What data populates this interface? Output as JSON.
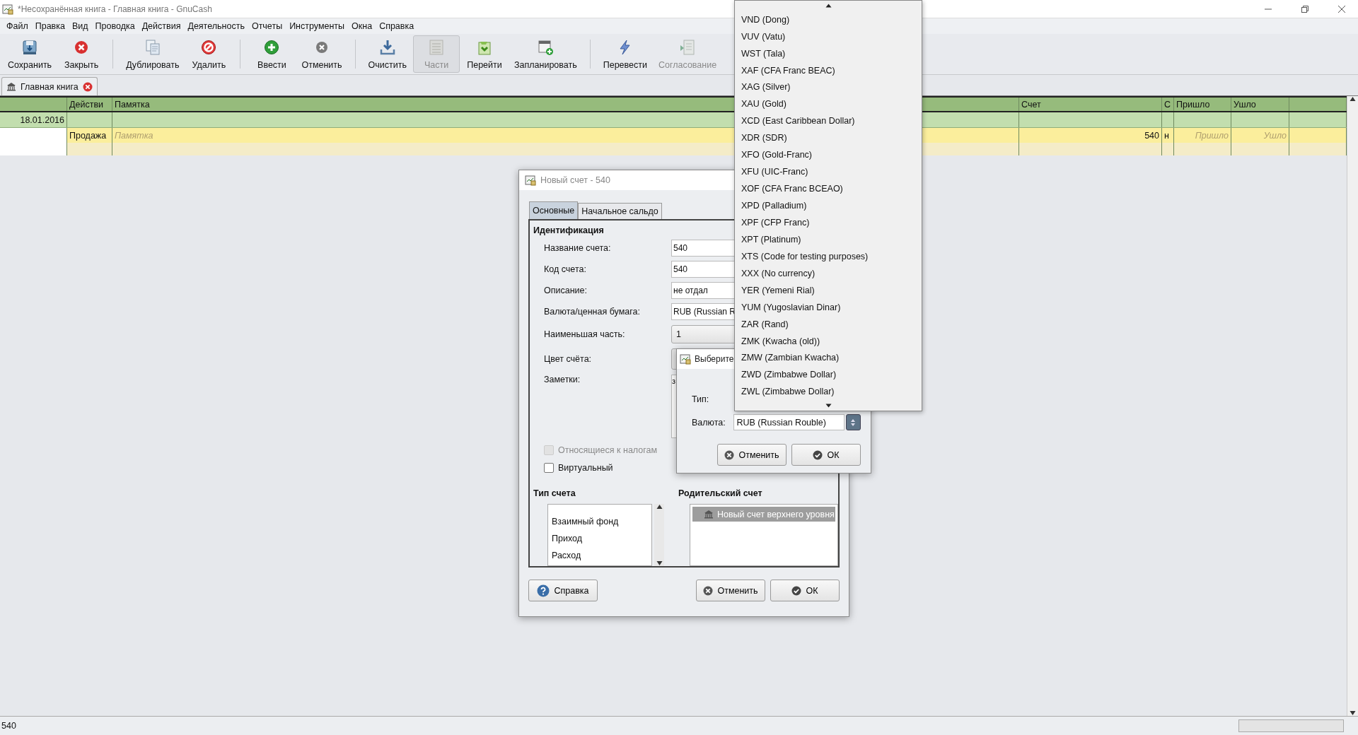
{
  "window": {
    "title": "*Несохранённая книга - Главная книга - GnuCash"
  },
  "menu": [
    "Файл",
    "Правка",
    "Вид",
    "Проводка",
    "Действия",
    "Деятельность",
    "Отчеты",
    "Инструменты",
    "Окна",
    "Справка"
  ],
  "toolbar": [
    {
      "items": [
        {
          "label": "Сохранить",
          "kind": "save",
          "disabled": false,
          "pressed": false
        },
        {
          "label": "Закрыть",
          "kind": "close",
          "disabled": false,
          "pressed": false
        }
      ]
    },
    {
      "items": [
        {
          "label": "Дублировать",
          "kind": "duplicate",
          "disabled": false,
          "pressed": false
        },
        {
          "label": "Удалить",
          "kind": "delete",
          "disabled": false,
          "pressed": false
        }
      ]
    },
    {
      "items": [
        {
          "label": "Ввести",
          "kind": "enter",
          "disabled": false,
          "pressed": false
        },
        {
          "label": "Отменить",
          "kind": "cancel",
          "disabled": false,
          "pressed": false
        }
      ]
    },
    {
      "items": [
        {
          "label": "Очистить",
          "kind": "blank",
          "disabled": false,
          "pressed": false
        },
        {
          "label": "Части",
          "kind": "split",
          "disabled": true,
          "pressed": true
        },
        {
          "label": "Перейти",
          "kind": "jump",
          "disabled": false,
          "pressed": false
        },
        {
          "label": "Запланировать",
          "kind": "schedule",
          "disabled": false,
          "pressed": false
        }
      ]
    },
    {
      "items": [
        {
          "label": "Перевести",
          "kind": "transfer",
          "disabled": false,
          "pressed": false
        },
        {
          "label": "Согласование",
          "kind": "reconcile",
          "disabled": true,
          "pressed": false
        }
      ]
    }
  ],
  "tabs": [
    {
      "label": "Главная книга",
      "selected": true
    }
  ],
  "register": {
    "columns": [
      "Действи",
      "Памятка",
      "Счет",
      "С",
      "Пришло",
      "Ушло"
    ],
    "rows": [
      {
        "kind": "transaction",
        "date": "18.01.2016",
        "selected": false
      },
      {
        "kind": "split",
        "cells": [
          {
            "value": "Продажа"
          },
          {
            "placeholder": "Памятка"
          },
          {
            "value": "540"
          },
          {
            "value": "н"
          },
          {
            "placeholder": "Пришло"
          },
          {
            "placeholder": "Ушло"
          }
        ],
        "selected": true
      },
      {
        "kind": "blank",
        "selected": false
      }
    ]
  },
  "status_bar": {
    "text": "540"
  },
  "account_dialog": {
    "title": "Новый счет - 540",
    "tabs": [
      {
        "label": "Основные",
        "selected": true
      },
      {
        "label": "Начальное сальдо",
        "selected": false
      }
    ],
    "section": "Идентификация",
    "fields": [
      {
        "kind": "text",
        "label": "Название счета:",
        "value": "540"
      },
      {
        "kind": "text",
        "label": "Код счета:",
        "value": "540"
      },
      {
        "kind": "text",
        "label": "Описание:",
        "value": "не отдал"
      },
      {
        "kind": "text",
        "label": "Валюта/ценная бумага:",
        "value": "RUB (Russian R"
      },
      {
        "kind": "combo",
        "label": "Наименьшая часть:",
        "value": "1"
      },
      {
        "kind": "color",
        "label": "Цвет счёта:"
      },
      {
        "kind": "notes",
        "label": "Заметки:",
        "value": "з"
      }
    ],
    "checkboxes": [
      {
        "label": "Относящиеся к налогам",
        "checked": false,
        "disabled": true
      },
      {
        "label": "Виртуальный",
        "checked": false,
        "disabled": false
      }
    ],
    "type_heading": "Тип счета",
    "types": [
      {
        "label": "Взаимный фонд",
        "selected": false
      },
      {
        "label": "Приход",
        "selected": false
      },
      {
        "label": "Расход",
        "selected": false
      }
    ],
    "parent_heading": "Родительский счет",
    "parents": [
      {
        "label": "Новый счет верхнего уровня",
        "selected": true
      }
    ],
    "buttons": [
      {
        "kind": "help",
        "label": "Справка"
      },
      {
        "kind": "cancel",
        "label": "Отменить"
      },
      {
        "kind": "ok",
        "label": "ОК"
      }
    ]
  },
  "commodity_dialog": {
    "title": "Выберите",
    "type_label": "Тип:",
    "currency_label": "Валюта:",
    "currency": "RUB (Russian Rouble)",
    "buttons": [
      {
        "kind": "cancel",
        "label": "Отменить"
      },
      {
        "kind": "ok",
        "label": "ОК"
      }
    ]
  },
  "currency_dropdown": {
    "items": [
      {
        "label": "VND (Dong)"
      },
      {
        "label": "VUV (Vatu)"
      },
      {
        "label": "WST (Tala)"
      },
      {
        "label": "XAF (CFA Franc BEAC)"
      },
      {
        "label": "XAG (Silver)"
      },
      {
        "label": "XAU (Gold)"
      },
      {
        "label": "XCD (East Caribbean Dollar)"
      },
      {
        "label": "XDR (SDR)"
      },
      {
        "label": "XFO (Gold-Franc)"
      },
      {
        "label": "XFU (UIC-Franc)"
      },
      {
        "label": "XOF (CFA Franc BCEAO)"
      },
      {
        "label": "XPD (Palladium)"
      },
      {
        "label": "XPF (CFP Franc)"
      },
      {
        "label": "XPT (Platinum)"
      },
      {
        "label": "XTS (Code for testing purposes)"
      },
      {
        "label": "XXX (No currency)"
      },
      {
        "label": "YER (Yemeni Rial)"
      },
      {
        "label": "YUM (Yugoslavian Dinar)"
      },
      {
        "label": "ZAR (Rand)"
      },
      {
        "label": "ZMK (Kwacha (old))"
      },
      {
        "label": "ZMW (Zambian Kwacha)"
      },
      {
        "label": "ZWD (Zimbabwe Dollar)"
      },
      {
        "label": "ZWL (Zimbabwe Dollar)"
      }
    ]
  }
}
